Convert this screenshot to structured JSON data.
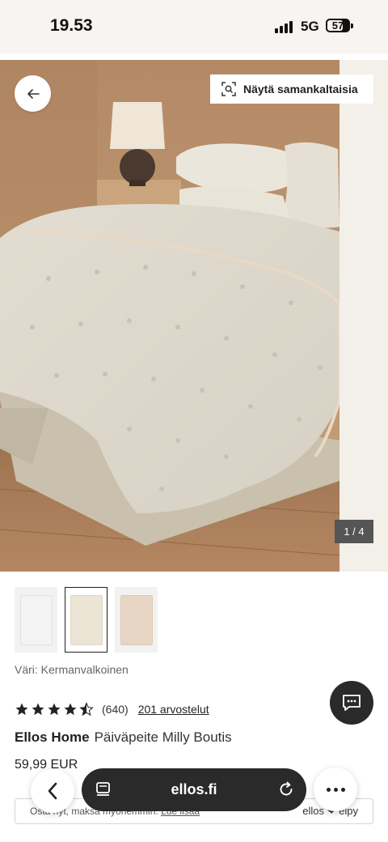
{
  "status_bar": {
    "time": "19.53",
    "network": "5G",
    "battery": "57"
  },
  "gallery": {
    "similar_label": "Näytä samankaltaisia",
    "counter": "1 / 4",
    "back_icon": "arrow-left-icon",
    "similar_icon": "visual-search-icon"
  },
  "thumbnails": [
    {
      "color": "#f3f3f3",
      "selected": false
    },
    {
      "color": "#ece4d5",
      "selected": true
    },
    {
      "color": "#e6d6c3",
      "selected": false
    }
  ],
  "product": {
    "color_label": "Väri: Kermanvalkoinen",
    "rating": 4.5,
    "rating_count": "(640)",
    "reviews_link": "201 arvostelut",
    "brand": "Ellos Home",
    "name": "Päiväpeite Milly Boutis",
    "price": "59,99 EUR"
  },
  "klarna": {
    "text": "Osta nyt, maksa myöhemmin.",
    "link": "Lue lisää",
    "logo": "ellos ❤ elpy"
  },
  "browser": {
    "url": "ellos.fi"
  },
  "colors": {
    "accent_dark": "#2a2a2a",
    "status_bg": "#f7f4f1"
  }
}
